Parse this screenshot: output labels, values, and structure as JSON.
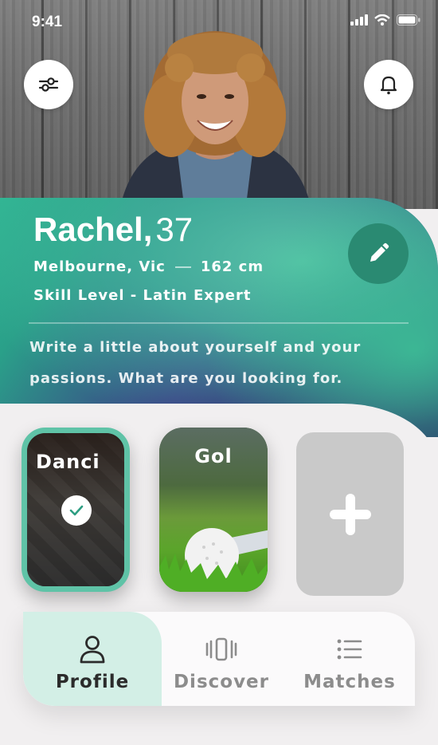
{
  "status_bar": {
    "time": "9:41"
  },
  "profile": {
    "name": "Rachel,",
    "age": "37",
    "location": "Melbourne, Vic",
    "height": "162 cm",
    "skill": "Skill Level - Latin Expert",
    "bio": "Write a little about yourself and your passions. What are you looking for."
  },
  "interests": [
    {
      "label": "Danci",
      "selected": true
    },
    {
      "label": "Gol",
      "selected": false
    }
  ],
  "nav": {
    "items": [
      {
        "label": "Profile",
        "icon": "person-icon",
        "active": true
      },
      {
        "label": "Discover",
        "icon": "cards-icon",
        "active": false
      },
      {
        "label": "Matches",
        "icon": "list-icon",
        "active": false
      }
    ]
  },
  "colors": {
    "accent": "#5fc3a7",
    "edit_button": "#2a8a72",
    "nav_active_bg": "#d3efe6",
    "nav_inactive_text": "#8c8c8c"
  }
}
